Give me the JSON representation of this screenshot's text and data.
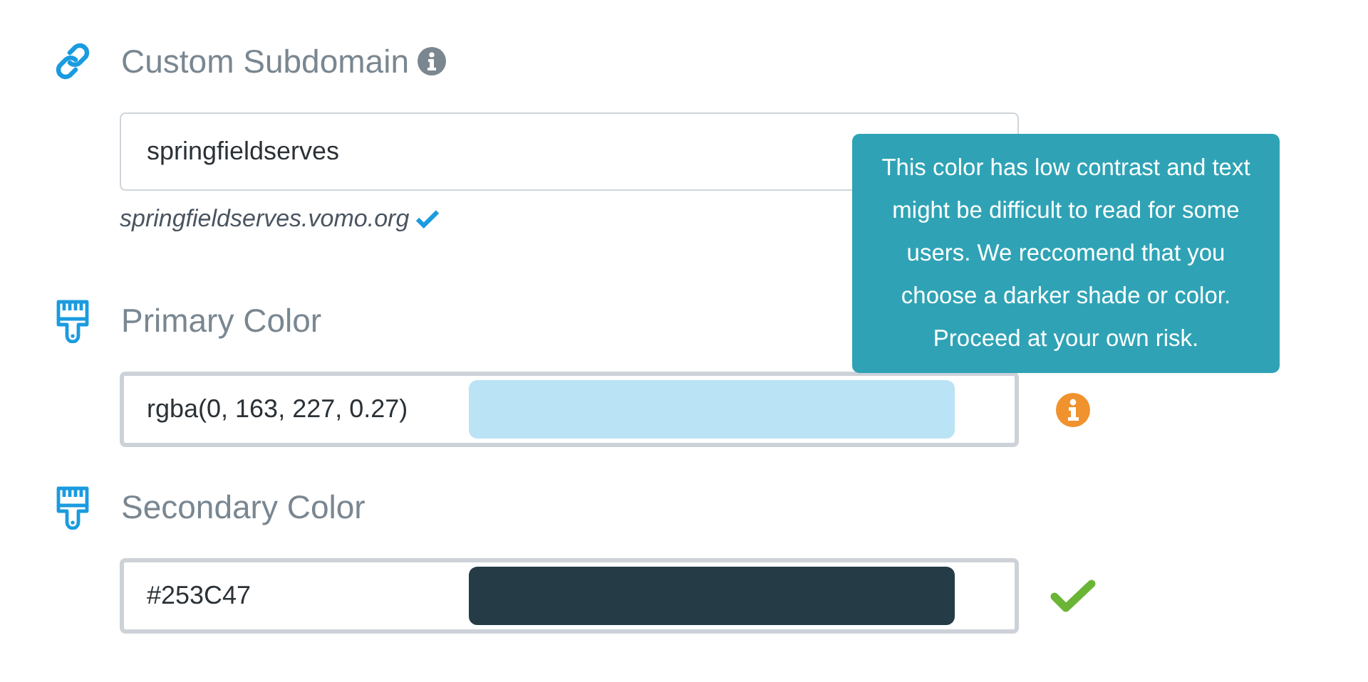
{
  "subdomain": {
    "label": "Custom Subdomain",
    "value": "springfieldserves",
    "url": "springfieldserves.vomo.org",
    "verified": true
  },
  "colors": [
    {
      "label": "Primary Color",
      "value": "rgba(0, 163, 227, 0.27)",
      "color": "#bae3f5",
      "kind": "warning"
    },
    {
      "label": "Secondary Color",
      "value": "#253C47",
      "color": "#253c47",
      "kind": "ok"
    }
  ],
  "tooltip": {
    "text": "This color has low contrast and text might be difficult to read for some users. We reccomend that you choose a darker shade or color. Proceed at your own risk."
  }
}
